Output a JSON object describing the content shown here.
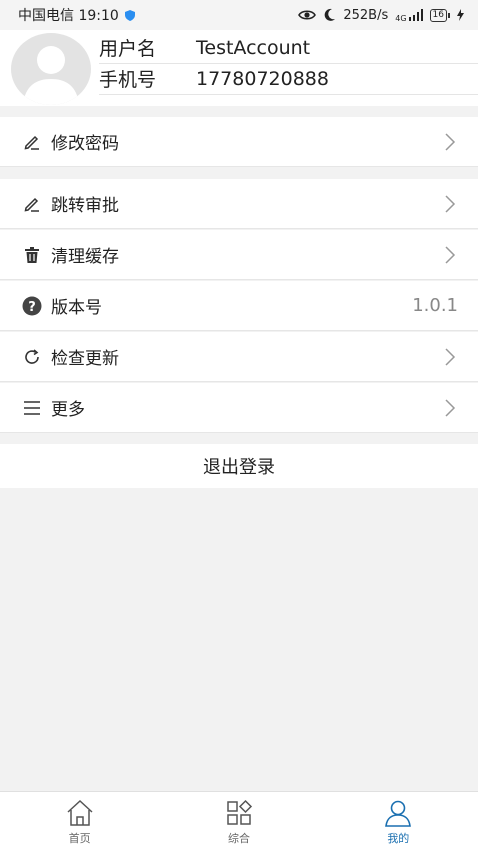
{
  "status_bar": {
    "carrier_time": "中国电信 19:10",
    "speed": "252B/s",
    "network": "4G",
    "battery": "16"
  },
  "profile": {
    "username_label": "用户名",
    "username_value": "TestAccount",
    "phone_label": "手机号",
    "phone_value": "17780720888"
  },
  "menu": {
    "change_password": "修改密码",
    "jump_approval": "跳转审批",
    "clear_cache": "清理缓存",
    "version_label": "版本号",
    "version_value": "1.0.1",
    "check_update": "检查更新",
    "more": "更多"
  },
  "logout_label": "退出登录",
  "tabs": {
    "home": "首页",
    "overview": "综合",
    "mine": "我的"
  },
  "colors": {
    "accent": "#1a6fb0",
    "background": "#f2f2f2"
  }
}
